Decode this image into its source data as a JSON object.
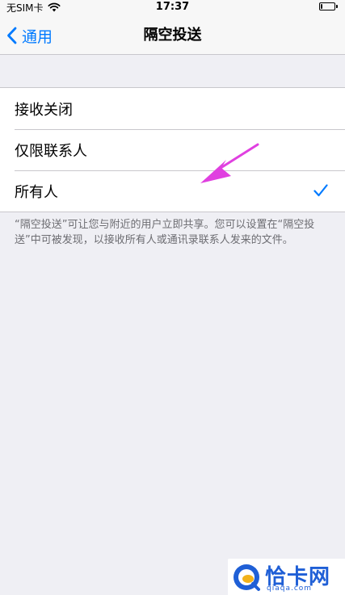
{
  "status_bar": {
    "carrier": "无SIM卡",
    "time": "17:37",
    "battery_level": 0.12
  },
  "nav_bar": {
    "back_label": "通用",
    "title": "隔空投送"
  },
  "receive_options": [
    {
      "label": "接收关闭",
      "selected": false
    },
    {
      "label": "仅限联系人",
      "selected": false
    },
    {
      "label": "所有人",
      "selected": true
    }
  ],
  "footer_note": "“隔空投送”可让您与附近的用户立即共享。您可以设置在“隔空投送”中可被发现，以接收所有人或通讯录联系人发来的文件。",
  "watermark": {
    "brand": "恰卡网",
    "domain": "qiaqa.com"
  },
  "icons": {
    "back": "chevron-left-icon",
    "check": "checkmark-icon",
    "wifi": "wifi-icon",
    "battery": "battery-icon",
    "annotation": "arrow-icon"
  },
  "colors": {
    "accent": "#007aff",
    "background": "#efeff4",
    "annotation": "#e040e0"
  }
}
